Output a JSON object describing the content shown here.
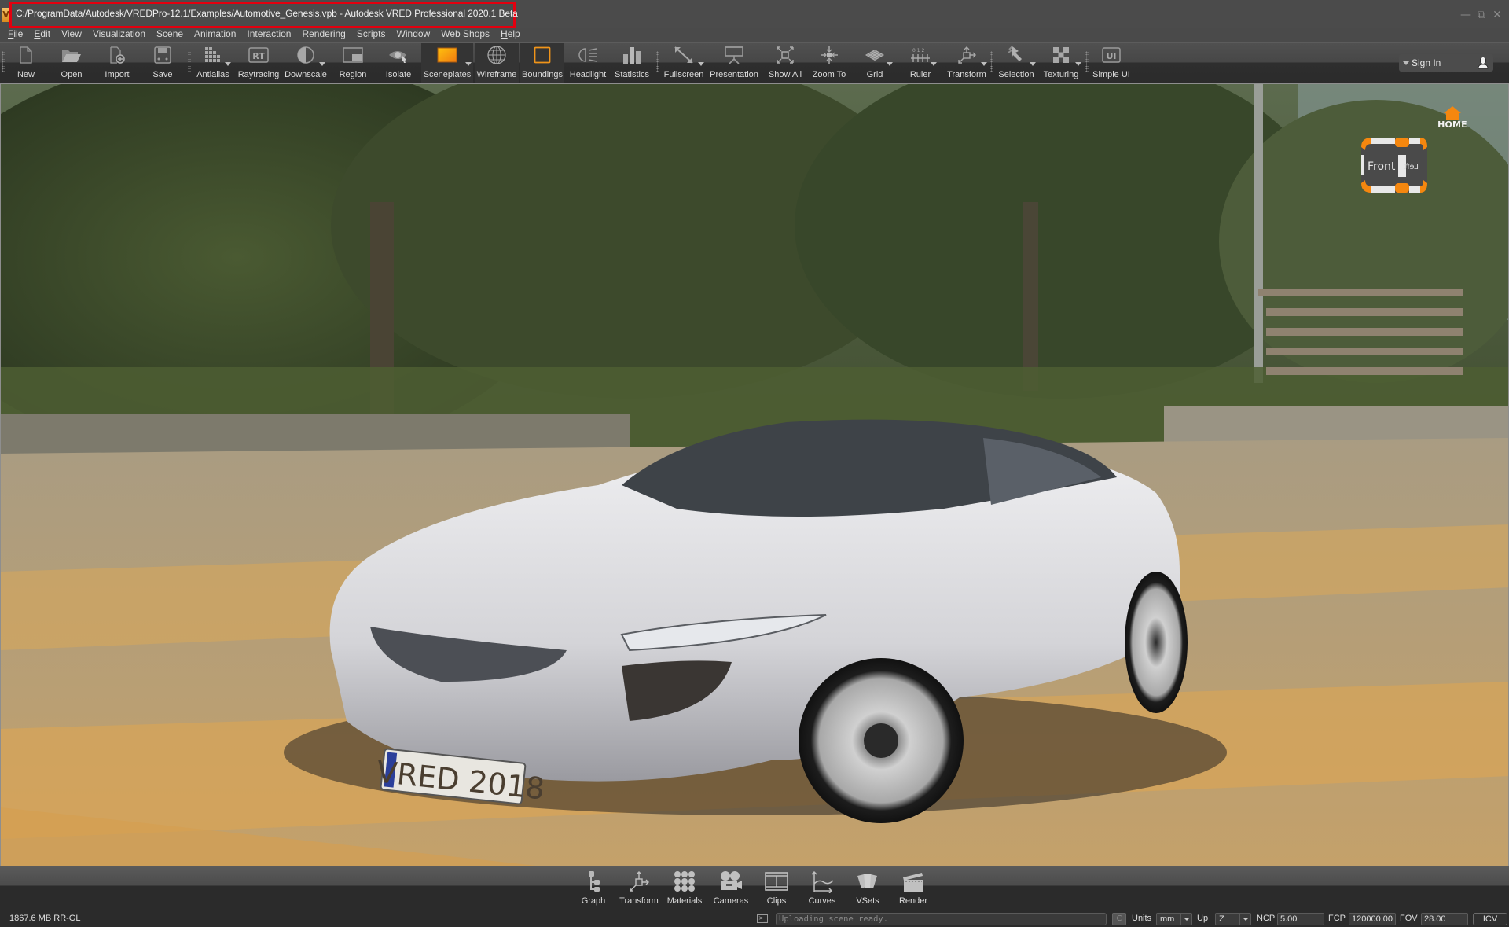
{
  "window": {
    "title": "C:/ProgramData/Autodesk/VREDPro-12.1/Examples/Automotive_Genesis.vpb - Autodesk VRED Professional 2020.1 Beta",
    "app_icon": "vred-logo-icon",
    "controls": [
      "minimize",
      "restore",
      "close"
    ]
  },
  "menu": [
    {
      "label": "File",
      "mnemonic": "F",
      "rest": "ile"
    },
    {
      "label": "Edit",
      "mnemonic": "E",
      "rest": "dit"
    },
    {
      "label": "View",
      "mnemonic": "",
      "rest": "View"
    },
    {
      "label": "Visualization",
      "mnemonic": "",
      "rest": "Visualization"
    },
    {
      "label": "Scene",
      "mnemonic": "",
      "rest": "Scene"
    },
    {
      "label": "Animation",
      "mnemonic": "",
      "rest": "Animation"
    },
    {
      "label": "Interaction",
      "mnemonic": "",
      "rest": "Interaction"
    },
    {
      "label": "Rendering",
      "mnemonic": "",
      "rest": "Rendering"
    },
    {
      "label": "Scripts",
      "mnemonic": "",
      "rest": "Scripts"
    },
    {
      "label": "Window",
      "mnemonic": "",
      "rest": "Window"
    },
    {
      "label": "Web Shops",
      "mnemonic": "",
      "rest": "Web Shops"
    },
    {
      "label": "Help",
      "mnemonic": "H",
      "rest": "elp"
    }
  ],
  "toolbar": {
    "tools": [
      {
        "label": "New",
        "icon": "new-document-icon"
      },
      {
        "label": "Open",
        "icon": "open-folder-icon"
      },
      {
        "label": "Import",
        "icon": "import-icon"
      },
      {
        "label": "Save",
        "icon": "save-icon"
      },
      {
        "label": "Antialias",
        "icon": "antialias-icon",
        "dropdown": true
      },
      {
        "label": "Raytracing",
        "icon": "raytracing-icon"
      },
      {
        "label": "Downscale",
        "icon": "downscale-icon",
        "dropdown": true
      },
      {
        "label": "Region",
        "icon": "region-icon"
      },
      {
        "label": "Isolate",
        "icon": "isolate-icon"
      },
      {
        "label": "Sceneplates",
        "icon": "sceneplates-icon",
        "dropdown": true,
        "active": true
      },
      {
        "label": "Wireframe",
        "icon": "wireframe-icon",
        "active": true
      },
      {
        "label": "Boundings",
        "icon": "boundings-icon",
        "active": true
      },
      {
        "label": "Headlight",
        "icon": "headlight-icon"
      },
      {
        "label": "Statistics",
        "icon": "statistics-icon"
      },
      {
        "label": "Fullscreen",
        "icon": "fullscreen-icon",
        "dropdown": true
      },
      {
        "label": "Presentation",
        "icon": "presentation-icon"
      },
      {
        "label": "Show All",
        "icon": "show-all-icon"
      },
      {
        "label": "Zoom To",
        "icon": "zoom-to-icon"
      },
      {
        "label": "Grid",
        "icon": "grid-icon",
        "dropdown": true
      },
      {
        "label": "Ruler",
        "icon": "ruler-icon",
        "dropdown": true
      },
      {
        "label": "Transform",
        "icon": "transform-icon",
        "dropdown": true
      },
      {
        "label": "Selection",
        "icon": "selection-icon",
        "dropdown": true
      },
      {
        "label": "Texturing",
        "icon": "texturing-icon",
        "dropdown": true
      },
      {
        "label": "Simple UI",
        "icon": "simple-ui-icon"
      }
    ],
    "sign_in": "Sign In"
  },
  "viewport": {
    "navcube": {
      "face_front": "Front",
      "face_side": "Left"
    },
    "home_label": "HOME",
    "license_plate": "VRED 2018",
    "accent_color": "#f5870f"
  },
  "dock": [
    {
      "label": "Graph",
      "icon": "graph-icon"
    },
    {
      "label": "Transform",
      "icon": "transform-icon"
    },
    {
      "label": "Materials",
      "icon": "materials-icon"
    },
    {
      "label": "Cameras",
      "icon": "cameras-icon"
    },
    {
      "label": "Clips",
      "icon": "clips-icon"
    },
    {
      "label": "Curves",
      "icon": "curves-icon"
    },
    {
      "label": "VSets",
      "icon": "vsets-icon"
    },
    {
      "label": "Render",
      "icon": "render-icon"
    }
  ],
  "status": {
    "memory": "1867.6 MB  RR-GL",
    "console_text": "Uploading scene ready.",
    "clear_label": "C",
    "units_label": "Units",
    "units_value": "mm",
    "up_label": "Up",
    "up_value": "Z",
    "ncp_label": "NCP",
    "ncp_value": "5.00",
    "fcp_label": "FCP",
    "fcp_value": "120000.00",
    "fov_label": "FOV",
    "fov_value": "28.00",
    "icv_label": "ICV"
  }
}
